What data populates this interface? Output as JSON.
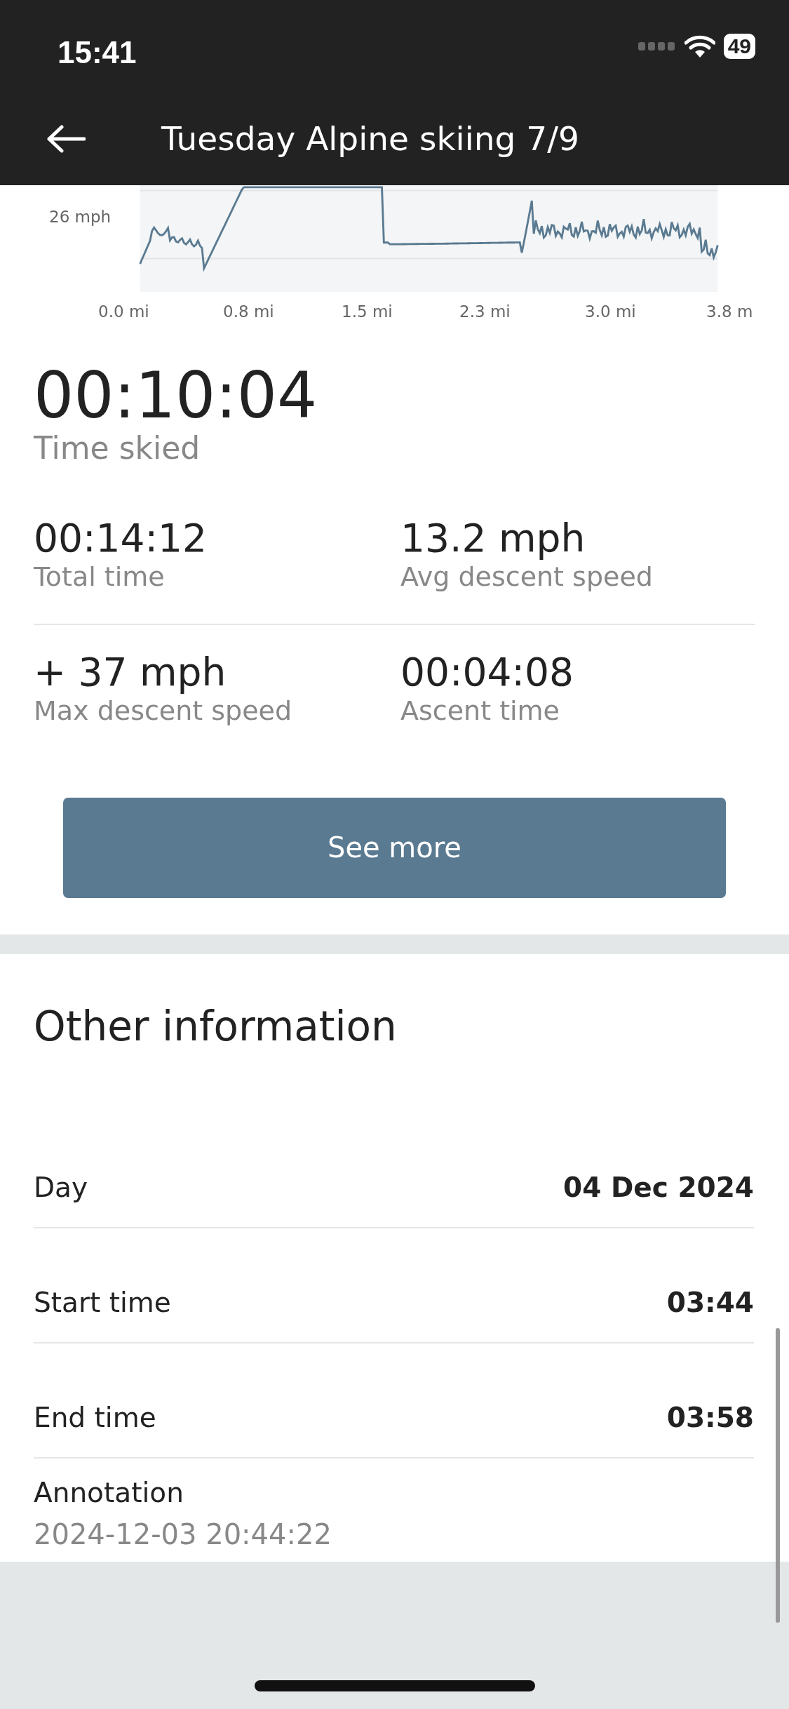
{
  "status_bar": {
    "time": "15:41",
    "battery": "49"
  },
  "header": {
    "title": "Tuesday Alpine skiing 7/9"
  },
  "chart": {
    "y_tick": "26 mph",
    "x_ticks": [
      "0.0 mi",
      "0.8 mi",
      "1.5 mi",
      "2.3 mi",
      "3.0 mi",
      "3.8 m"
    ]
  },
  "summary": {
    "value": "00:10:04",
    "label": "Time skied"
  },
  "stats": [
    {
      "value": "00:14:12",
      "label": "Total time"
    },
    {
      "value": "13.2 mph",
      "label": "Avg descent speed"
    },
    {
      "value": "+ 37 mph",
      "label": "Max descent speed"
    },
    {
      "value": "00:04:08",
      "label": "Ascent time"
    }
  ],
  "see_more_button": "See more",
  "other_information": {
    "title": "Other information",
    "rows": [
      {
        "kind": "pair",
        "label": "Day",
        "value": "04 Dec 2024"
      },
      {
        "kind": "pair",
        "label": "Start time",
        "value": "03:44"
      },
      {
        "kind": "pair",
        "label": "End time",
        "value": "03:58"
      },
      {
        "kind": "stacked",
        "label": "Annotation",
        "value": "2024-12-03 20:44:22"
      }
    ]
  }
}
